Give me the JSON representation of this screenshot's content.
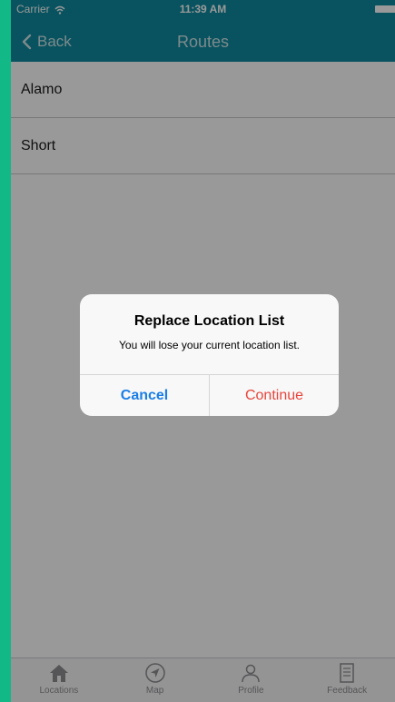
{
  "status_bar": {
    "carrier": "Carrier",
    "time": "11:39 AM",
    "wifi_icon": "wifi-icon",
    "battery_icon": "battery-icon"
  },
  "nav_bar": {
    "back_label": "Back",
    "back_icon": "chevron-left-icon",
    "title": "Routes"
  },
  "routes": [
    {
      "name": "Alamo"
    },
    {
      "name": "Short"
    }
  ],
  "alert": {
    "title": "Replace Location List",
    "message": "You will lose your current location list.",
    "cancel_label": "Cancel",
    "continue_label": "Continue"
  },
  "tab_bar": {
    "tabs": [
      {
        "label": "Locations",
        "icon": "home-icon"
      },
      {
        "label": "Map",
        "icon": "navigation-arrow-icon"
      },
      {
        "label": "Profile",
        "icon": "person-icon"
      },
      {
        "label": "Feedback",
        "icon": "document-icon"
      }
    ]
  },
  "colors": {
    "frame": "#12b886",
    "nav_bar": "#0e8a9e",
    "cancel": "#1a7ee6",
    "continue": "#e8453c"
  }
}
